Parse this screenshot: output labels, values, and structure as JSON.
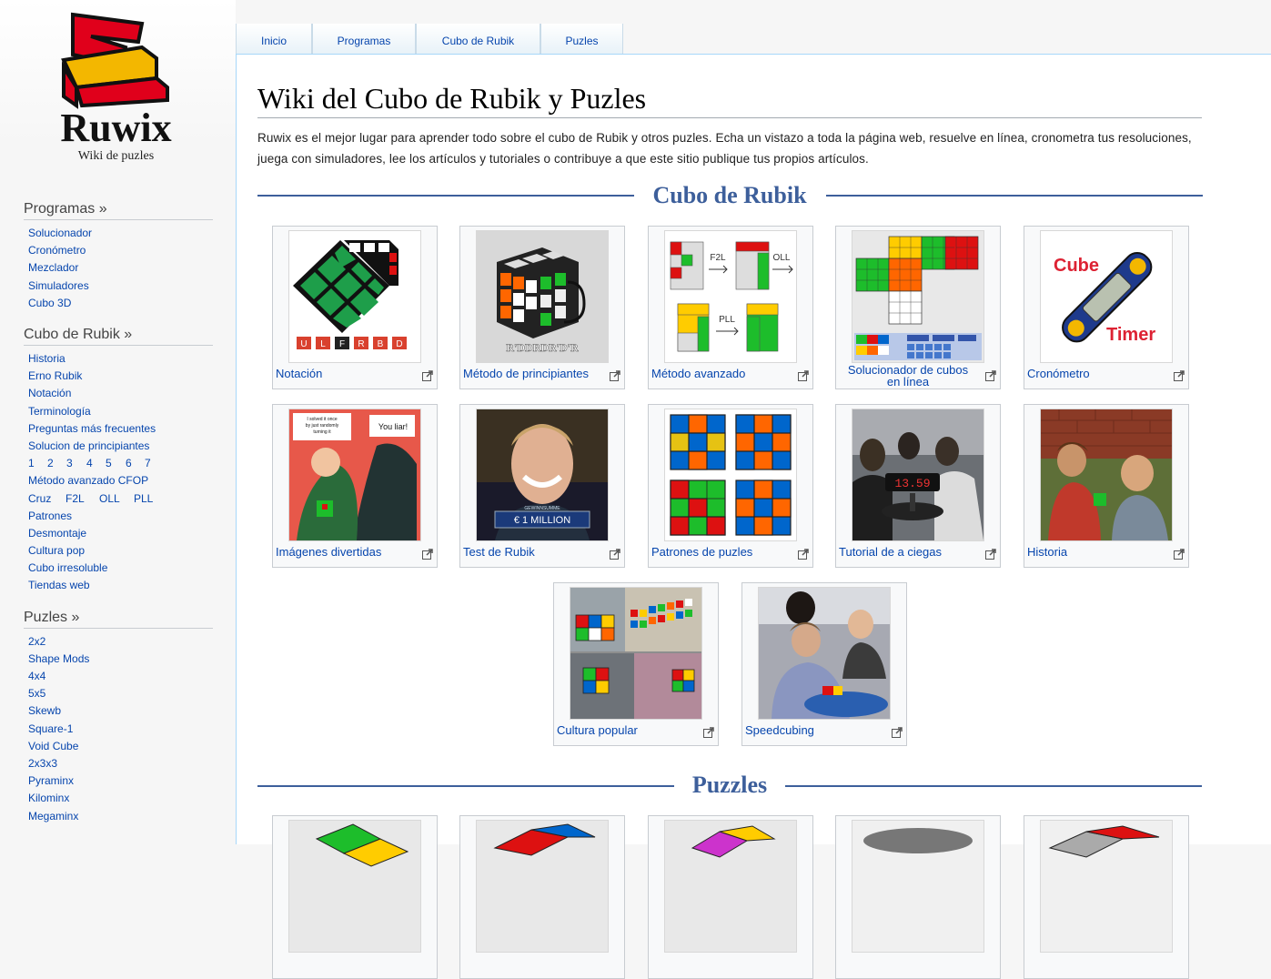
{
  "site": {
    "name": "Ruwix",
    "tagline": "Wiki de puzles"
  },
  "tabs": [
    "Inicio",
    "Programas",
    "Cubo de Rubik",
    "Puzles"
  ],
  "sidebar": {
    "programas": {
      "title": "Programas",
      "arrow": "»",
      "items": [
        "Solucionador",
        "Cronómetro",
        "Mezclador",
        "Simuladores",
        "Cubo 3D"
      ]
    },
    "cubo": {
      "title": "Cubo de Rubik",
      "arrow": "»",
      "items": [
        "Historia",
        "Erno Rubik",
        "Notación",
        "Terminología",
        "Preguntas más frecuentes",
        "Solucion de principiantes"
      ],
      "steps": [
        "1",
        "2",
        "3",
        "4",
        "5",
        "6",
        "7"
      ],
      "items2": [
        "Método avanzado CFOP"
      ],
      "cfop": [
        "Cruz",
        "F2L",
        "OLL",
        "PLL"
      ],
      "items3": [
        "Patrones",
        "Desmontaje",
        "Cultura pop",
        "Cubo irresoluble",
        "Tiendas web"
      ]
    },
    "puzles": {
      "title": "Puzles",
      "arrow": "»",
      "items": [
        "2x2",
        "Shape Mods",
        "4x4",
        "5x5",
        "Skewb",
        "Square-1",
        "Void Cube",
        "2x3x3",
        "Pyraminx",
        "Kilominx",
        "Megaminx"
      ]
    }
  },
  "main": {
    "title": "Wiki del Cubo de Rubik y Puzles",
    "intro": "Ruwix es el mejor lugar para aprender todo sobre el cubo de Rubik y otros puzles. Echa un vistazo a toda la página web, resuelve en línea, cronometra tus resoluciones, juega con simuladores, lee los artículos y tutoriales o contribuye a que este sitio publique tus propios artículos.",
    "section1": "Cubo de Rubik",
    "section2": "Puzzles",
    "cards": [
      {
        "caption": "Notación",
        "thumb_text": "U L F R B D"
      },
      {
        "caption": "Método de principiantes",
        "thumb_text": "R'DDRDR'D'R"
      },
      {
        "caption": "Método avanzado",
        "thumb_text": "F2L OLL PLL"
      },
      {
        "caption": "Solucionador de cubos en línea",
        "thumb_text": "Reset Scramble Solve"
      },
      {
        "caption": "Cronómetro",
        "thumb_text": "Cube Timer"
      },
      {
        "caption": "Imágenes divertidas",
        "thumb_text": "I solved it once by just randomly turning it / You liar!"
      },
      {
        "caption": "Test de Rubik",
        "thumb_text": "GEWINNSUMME € 1 MILLION"
      },
      {
        "caption": "Patrones de puzles",
        "thumb_text": ""
      },
      {
        "caption": "Tutorial de a ciegas",
        "thumb_text": "13.59"
      },
      {
        "caption": "Historia",
        "thumb_text": ""
      },
      {
        "caption": "Cultura popular",
        "thumb_text": ""
      },
      {
        "caption": "Speedcubing",
        "thumb_text": ""
      }
    ]
  }
}
